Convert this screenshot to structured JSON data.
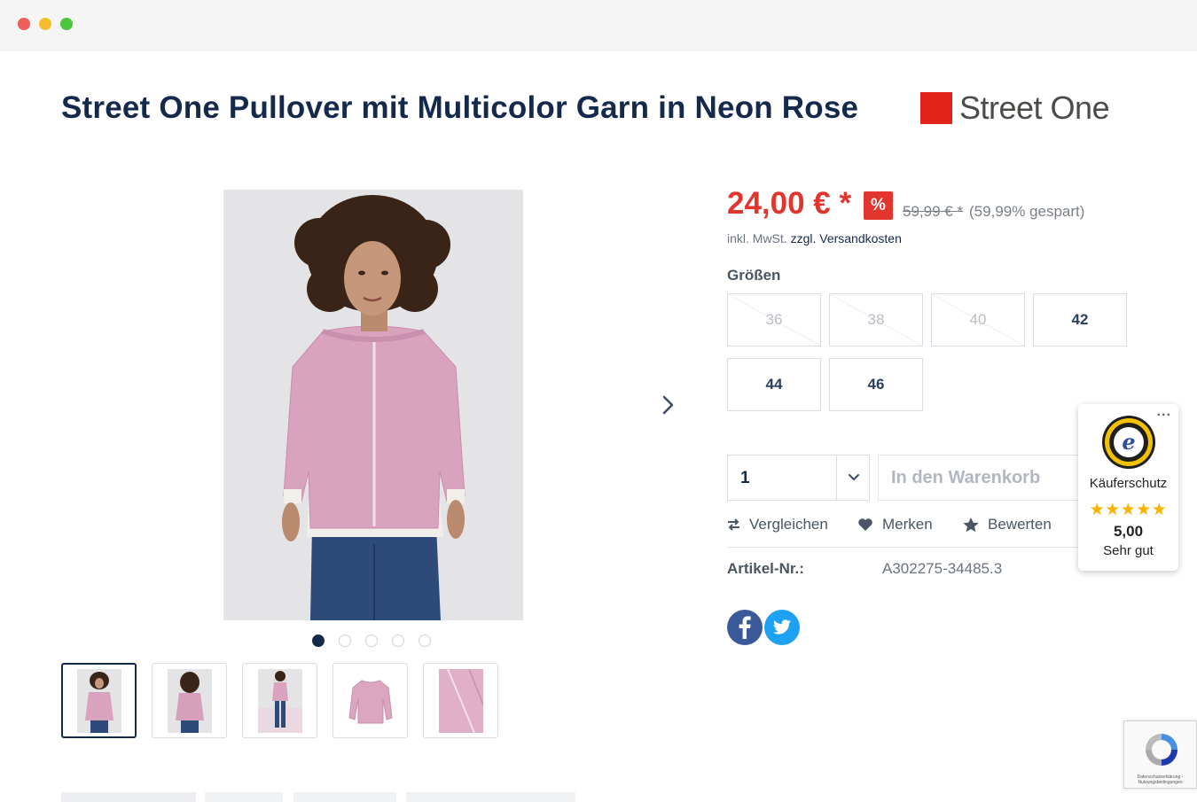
{
  "product": {
    "title": "Street One Pullover mit Multicolor Garn in Neon Rose",
    "brand": "Street One",
    "price": "24,00 € *",
    "discount_badge": "%",
    "old_price": "59,99 € *",
    "saved": "(59,99% gespart)",
    "tax_note": "inkl. MwSt.",
    "shipping_link": "zzgl. Versandkosten",
    "sizes_label": "Größen",
    "sizes": [
      {
        "label": "36",
        "available": false
      },
      {
        "label": "38",
        "available": false
      },
      {
        "label": "40",
        "available": false
      },
      {
        "label": "42",
        "available": true
      },
      {
        "label": "44",
        "available": true
      },
      {
        "label": "46",
        "available": true
      }
    ],
    "quantity": "1",
    "add_to_cart": "In den Warenkorb",
    "actions": {
      "compare": "Vergleichen",
      "wishlist": "Merken",
      "review": "Bewerten"
    },
    "article_label": "Artikel-Nr.:",
    "article_number": "A302275-34485.3"
  },
  "gallery": {
    "slides": 5,
    "active_slide": 1,
    "thumbnails": [
      "front view",
      "back view",
      "full body",
      "flat lay",
      "fabric detail"
    ]
  },
  "trust_badge": {
    "menu": "...",
    "label": "Käuferschutz",
    "stars": "★★★★★",
    "score": "5,00",
    "rating_text": "Sehr gut"
  },
  "recaptcha": {
    "text": "Datenschutzerklärung - Nutzungsbedingungen"
  },
  "colors": {
    "brand_red": "#e2231a",
    "price_red": "#e2352e",
    "navy": "#15294d"
  }
}
